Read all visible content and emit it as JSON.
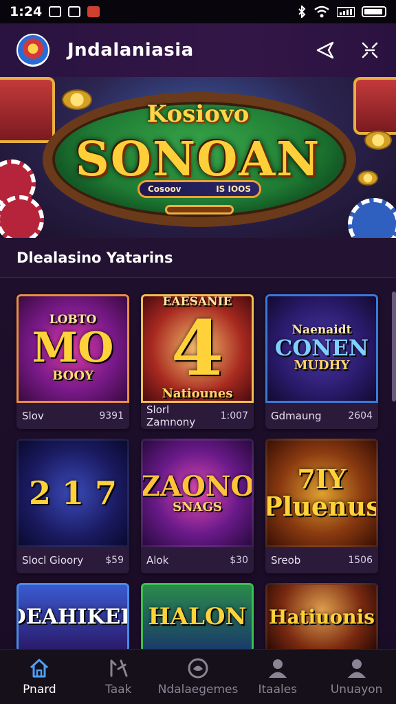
{
  "status_bar": {
    "time": "1:24"
  },
  "app_bar": {
    "title": "Jndalaniasia"
  },
  "hero": {
    "kicker": "Kosiovo",
    "title": "SONOAN",
    "pill_left": "Cosoov",
    "pill_right": "IS IOOS"
  },
  "section": {
    "title": "Dlealasino Yatarins"
  },
  "games": [
    {
      "thumb_text": "MO",
      "thumb_top": "LOBTO",
      "thumb_bottom": "BOOY",
      "name": "Slov",
      "price": "9391",
      "thumb_color": "#ffd23a"
    },
    {
      "thumb_text": "4",
      "thumb_top": "EAESANIE",
      "thumb_bottom": "Natiounes",
      "name": "Slorl Zamnony",
      "price": "1:007",
      "thumb_color": "#ffd23a"
    },
    {
      "thumb_text": "CONEN",
      "thumb_top": "Naenaidt",
      "thumb_bottom": "MUDHY",
      "name": "Gdmaung",
      "price": "2604",
      "thumb_color": "#7fd0ff"
    },
    {
      "thumb_text": "2 1 7",
      "thumb_top": "",
      "thumb_bottom": "",
      "name": "Slocl Gioory",
      "price": "$59",
      "thumb_color": "#ffd23a"
    },
    {
      "thumb_text": "ZAONO",
      "thumb_top": "",
      "thumb_bottom": "SNAGS",
      "name": "Alok",
      "price": "$30",
      "thumb_color": "#ffc23a"
    },
    {
      "thumb_text": "7IY Pluenus",
      "thumb_top": "",
      "thumb_bottom": "",
      "name": "Sreob",
      "price": "1506",
      "thumb_color": "#ffd23a"
    },
    {
      "thumb_text": "DEAHIKER",
      "thumb_top": "",
      "thumb_bottom": "",
      "name": "",
      "price": "",
      "thumb_color": "#ffffff"
    },
    {
      "thumb_text": "HALON",
      "thumb_top": "",
      "thumb_bottom": "",
      "name": "",
      "price": "",
      "thumb_color": "#ffd23a"
    },
    {
      "thumb_text": "Hatiuonis",
      "thumb_top": "",
      "thumb_bottom": "",
      "name": "",
      "price": "",
      "thumb_color": "#ffd23a"
    }
  ],
  "bottom_nav": [
    {
      "label": "Pnard",
      "icon": "home-icon",
      "active": true
    },
    {
      "label": "Taak",
      "icon": "tools-icon",
      "active": false
    },
    {
      "label": "Ndalaegemes",
      "icon": "game-icon",
      "active": false
    },
    {
      "label": "Itaales",
      "icon": "user-icon",
      "active": false
    },
    {
      "label": "Unuayon",
      "icon": "profile-icon",
      "active": false
    }
  ],
  "colors": {
    "accent": "#4aa0ff",
    "background": "#1e0f2c",
    "app_bar": "#321647"
  }
}
